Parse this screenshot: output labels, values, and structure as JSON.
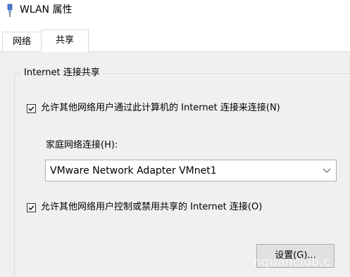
{
  "window": {
    "title": "WLAN 属性",
    "icon": "network-adapter-icon"
  },
  "tabs": [
    {
      "label": "网络",
      "selected": false
    },
    {
      "label": "共享",
      "selected": true
    }
  ],
  "ics": {
    "group_title": "Internet 连接共享",
    "allow_share": {
      "label": "允许其他网络用户通过此计算机的 Internet 连接来连接(N)",
      "checked": true
    },
    "home_connection_label": "家庭网络连接(H):",
    "home_connection_value": "VMware Network Adapter VMnet1",
    "allow_control": {
      "label": "允许其他网络用户控制或禁用共享的 Internet 连接(O)",
      "checked": true
    },
    "settings_button": "设置(G)..."
  },
  "watermark": "nquanclub.c"
}
